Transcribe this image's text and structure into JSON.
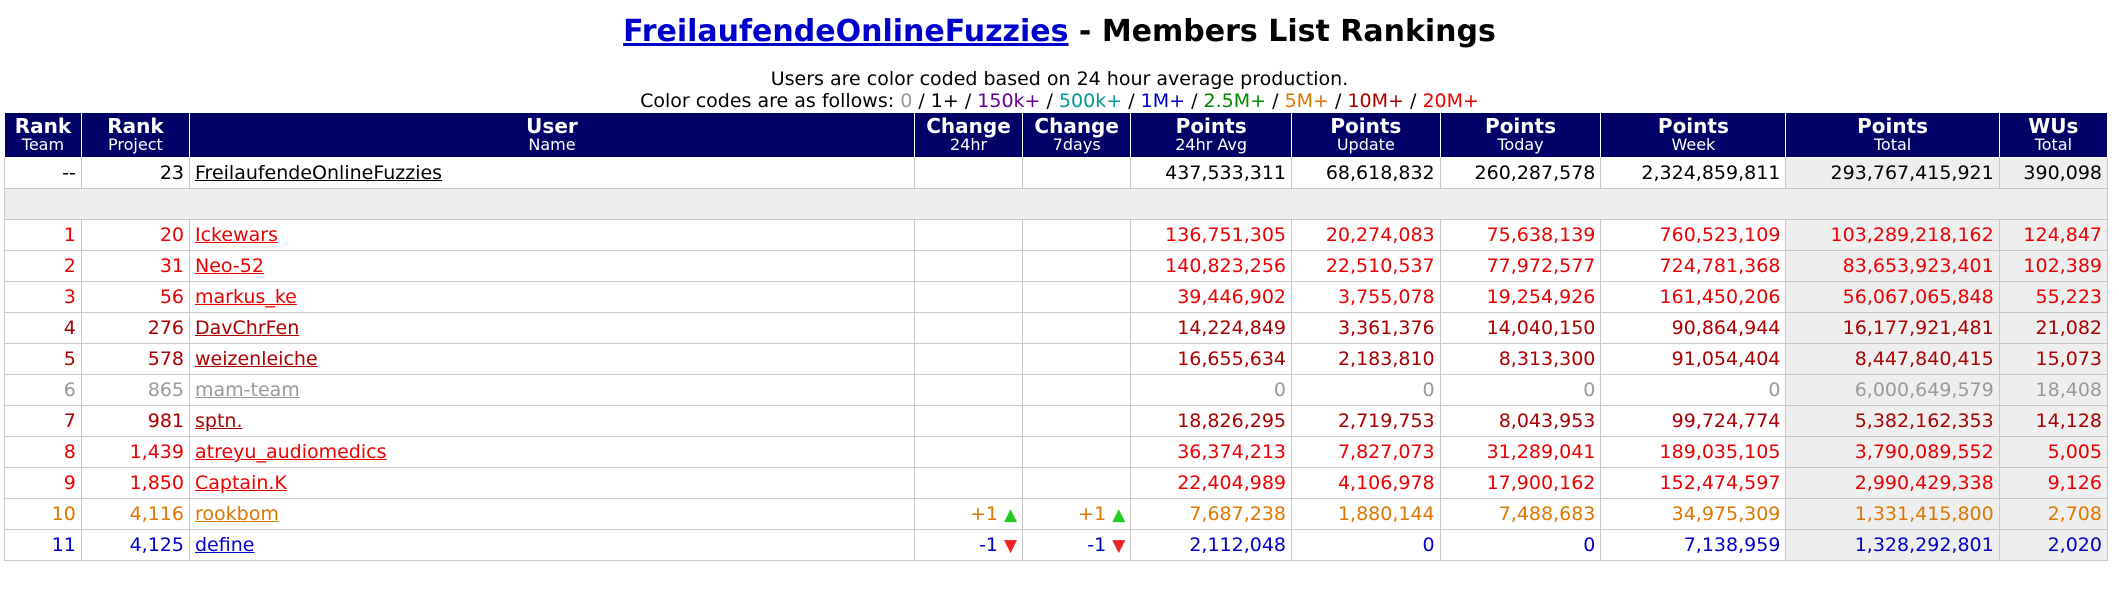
{
  "header": {
    "team_link": "FreilaufendeOnlineFuzzies",
    "title_suffix": " - Members List Rankings",
    "legend_line1": "Users are color coded based on 24 hour average production.",
    "legend_prefix": "Color codes are as follows: ",
    "codes": [
      {
        "label": "0",
        "color": "#999999"
      },
      {
        "label": "1+",
        "color": "#000000"
      },
      {
        "label": "150k+",
        "color": "#660099"
      },
      {
        "label": "500k+",
        "color": "#009999"
      },
      {
        "label": "1M+",
        "color": "#0000cc"
      },
      {
        "label": "2.5M+",
        "color": "#008800"
      },
      {
        "label": "5M+",
        "color": "#dd7700"
      },
      {
        "label": "10M+",
        "color": "#aa0000"
      },
      {
        "label": "20M+",
        "color": "#ee0000"
      }
    ]
  },
  "columns": [
    {
      "top": "Rank",
      "sub": "Team"
    },
    {
      "top": "Rank",
      "sub": "Project"
    },
    {
      "top": "User",
      "sub": "Name"
    },
    {
      "top": "Change",
      "sub": "24hr"
    },
    {
      "top": "Change",
      "sub": "7days"
    },
    {
      "top": "Points",
      "sub": "24hr Avg"
    },
    {
      "top": "Points",
      "sub": "Update"
    },
    {
      "top": "Points",
      "sub": "Today"
    },
    {
      "top": "Points",
      "sub": "Week"
    },
    {
      "top": "Points",
      "sub": "Total"
    },
    {
      "top": "WUs",
      "sub": "Total"
    }
  ],
  "team_row": {
    "rank_team": "--",
    "rank_project": "23",
    "name": "FreilaufendeOnlineFuzzies",
    "chg24": "",
    "chg7": "",
    "avg": "437,533,311",
    "update": "68,618,832",
    "today": "260,287,578",
    "week": "2,324,859,811",
    "total": "293,767,415,921",
    "wus": "390,098"
  },
  "rows": [
    {
      "color": "#ee0000",
      "rank_team": "1",
      "rank_project": "20",
      "name": "Ickewars",
      "chg24": "",
      "chg24_dir": "",
      "chg7": "",
      "chg7_dir": "",
      "avg": "136,751,305",
      "update": "20,274,083",
      "today": "75,638,139",
      "week": "760,523,109",
      "total": "103,289,218,162",
      "wus": "124,847"
    },
    {
      "color": "#ee0000",
      "rank_team": "2",
      "rank_project": "31",
      "name": "Neo-52",
      "chg24": "",
      "chg24_dir": "",
      "chg7": "",
      "chg7_dir": "",
      "avg": "140,823,256",
      "update": "22,510,537",
      "today": "77,972,577",
      "week": "724,781,368",
      "total": "83,653,923,401",
      "wus": "102,389"
    },
    {
      "color": "#ee0000",
      "rank_team": "3",
      "rank_project": "56",
      "name": "markus_ke",
      "chg24": "",
      "chg24_dir": "",
      "chg7": "",
      "chg7_dir": "",
      "avg": "39,446,902",
      "update": "3,755,078",
      "today": "19,254,926",
      "week": "161,450,206",
      "total": "56,067,065,848",
      "wus": "55,223"
    },
    {
      "color": "#aa0000",
      "rank_team": "4",
      "rank_project": "276",
      "name": "DavChrFen",
      "chg24": "",
      "chg24_dir": "",
      "chg7": "",
      "chg7_dir": "",
      "avg": "14,224,849",
      "update": "3,361,376",
      "today": "14,040,150",
      "week": "90,864,944",
      "total": "16,177,921,481",
      "wus": "21,082"
    },
    {
      "color": "#aa0000",
      "rank_team": "5",
      "rank_project": "578",
      "name": "weizenleiche",
      "chg24": "",
      "chg24_dir": "",
      "chg7": "",
      "chg7_dir": "",
      "avg": "16,655,634",
      "update": "2,183,810",
      "today": "8,313,300",
      "week": "91,054,404",
      "total": "8,447,840,415",
      "wus": "15,073"
    },
    {
      "color": "#999999",
      "rank_team": "6",
      "rank_project": "865",
      "name": "mam-team",
      "chg24": "",
      "chg24_dir": "",
      "chg7": "",
      "chg7_dir": "",
      "avg": "0",
      "update": "0",
      "today": "0",
      "week": "0",
      "total": "6,000,649,579",
      "wus": "18,408"
    },
    {
      "color": "#aa0000",
      "rank_team": "7",
      "rank_project": "981",
      "name": "sptn.",
      "chg24": "",
      "chg24_dir": "",
      "chg7": "",
      "chg7_dir": "",
      "avg": "18,826,295",
      "update": "2,719,753",
      "today": "8,043,953",
      "week": "99,724,774",
      "total": "5,382,162,353",
      "wus": "14,128"
    },
    {
      "color": "#ee0000",
      "rank_team": "8",
      "rank_project": "1,439",
      "name": "atreyu_audiomedics",
      "chg24": "",
      "chg24_dir": "",
      "chg7": "",
      "chg7_dir": "",
      "avg": "36,374,213",
      "update": "7,827,073",
      "today": "31,289,041",
      "week": "189,035,105",
      "total": "3,790,089,552",
      "wus": "5,005"
    },
    {
      "color": "#ee0000",
      "rank_team": "9",
      "rank_project": "1,850",
      "name": "Captain.K",
      "chg24": "",
      "chg24_dir": "",
      "chg7": "",
      "chg7_dir": "",
      "avg": "22,404,989",
      "update": "4,106,978",
      "today": "17,900,162",
      "week": "152,474,597",
      "total": "2,990,429,338",
      "wus": "9,126"
    },
    {
      "color": "#dd7700",
      "rank_team": "10",
      "rank_project": "4,116",
      "name": "rookbom",
      "chg24": "+1",
      "chg24_dir": "up",
      "chg7": "+1",
      "chg7_dir": "up",
      "avg": "7,687,238",
      "update": "1,880,144",
      "today": "7,488,683",
      "week": "34,975,309",
      "total": "1,331,415,800",
      "wus": "2,708"
    },
    {
      "color": "#0000cc",
      "rank_team": "11",
      "rank_project": "4,125",
      "name": "define",
      "chg24": "-1",
      "chg24_dir": "down",
      "chg7": "-1",
      "chg7_dir": "down",
      "avg": "2,112,048",
      "update": "0",
      "today": "0",
      "week": "7,138,959",
      "total": "1,328,292,801",
      "wus": "2,020"
    }
  ],
  "icons": {
    "up": "up-arrow-icon",
    "down": "down-arrow-icon"
  }
}
